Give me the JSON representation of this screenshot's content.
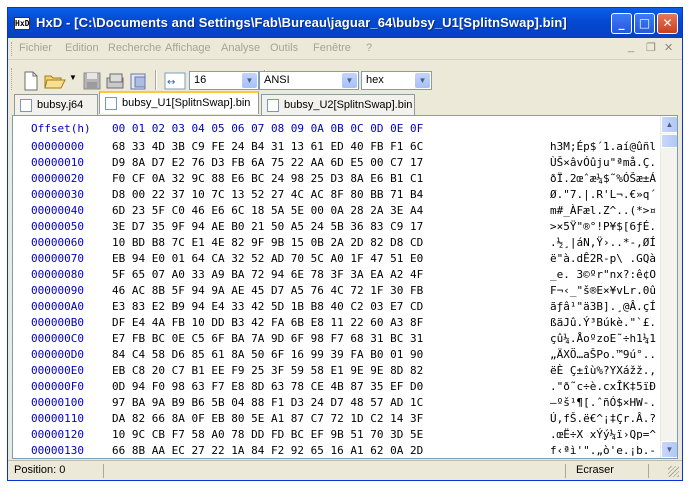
{
  "window": {
    "app_icon_text": "HxD",
    "title": "HxD - [C:\\Documents and Settings\\Fab\\Bureau\\jaguar_64\\bubsy_U1[SplitnSwap].bin]",
    "caption_buttons": {
      "minimize": "_",
      "maximize": "□",
      "close": "✕"
    }
  },
  "menubar": {
    "items": [
      "Fichier",
      "Edition",
      "Recherche",
      "Affichage",
      "Analyse",
      "Outils",
      "Fenêtre",
      "?"
    ],
    "mdi_buttons": {
      "minimize": "_",
      "restore": "❐",
      "close": "✕"
    }
  },
  "toolbar": {
    "bytes_per_row": "16",
    "charset": "ANSI",
    "display": "hex",
    "icons": [
      "new-file-icon",
      "open-folder-icon",
      "save-icon",
      "save-all-icon",
      "properties-icon",
      "bytes-per-row-icon"
    ]
  },
  "tabs": [
    {
      "label": "bubsy.j64",
      "active": false
    },
    {
      "label": "bubsy_U1[SplitnSwap].bin",
      "active": true
    },
    {
      "label": "bubsy_U2[SplitnSwap].bin",
      "active": false
    }
  ],
  "editor": {
    "offset_header": "Offset(h)",
    "column_header": "00 01 02 03 04 05 06 07 08 09 0A 0B 0C 0D 0E 0F",
    "rows": [
      {
        "offset": "00000000",
        "hex": "68 33 4D 3B C9 FE 24 B4 31 13 61 ED 40 FB F1 6C",
        "text": "h3M;Ép$´1.aí@ûñl"
      },
      {
        "offset": "00000010",
        "hex": "D9 8A D7 E2 76 D3 FB 6A 75 22 AA 6D E5 00 C7 17",
        "text": "ÙŠ×âvÓûju\"ªmå.Ç."
      },
      {
        "offset": "00000020",
        "hex": "F0 CF 0A 32 9C 88 E6 BC 24 98 25 D3 8A E6 B1 C1",
        "text": "ðÏ.2œˆæ¼$˜%ÓŠæ±Á"
      },
      {
        "offset": "00000030",
        "hex": "D8 00 22 37 10 7C 13 52 27 4C AC 8F 80 BB 71 B4",
        "text": "Ø.\"7.|.R'L¬.€»q´"
      },
      {
        "offset": "00000040",
        "hex": "6D 23 5F C0 46 E6 6C 18 5A 5E 00 0A 28 2A 3E A4",
        "text": "m#_ÀFæl.Z^..(*>¤"
      },
      {
        "offset": "00000050",
        "hex": "3E D7 35 9F 94 AE B0 21 50 A5 24 5B 36 83 C9 17",
        "text": ">×5Ÿ\"®°!P¥$[6ƒÉ."
      },
      {
        "offset": "00000060",
        "hex": "10 BD B8 7C E1 4E 82 9F 9B 15 0B 2A 2D 82 D8 CD",
        "text": ".½¸|áN‚Ÿ›..*-‚ØÍ"
      },
      {
        "offset": "00000070",
        "hex": "EB 94 E0 01 64 CA 32 52 AD 70 5C A0 1F 47 51 E0",
        "text": "ë\"à.dÊ2R-p\\ .GQà"
      },
      {
        "offset": "00000080",
        "hex": "5F 65 07 A0 33 A9 BA 72 94 6E 78 3F 3A EA A2 4F",
        "text": "_e. 3©ºr\"nx?:ê¢O"
      },
      {
        "offset": "00000090",
        "hex": "46 AC 8B 5F 94 9A AE 45 D7 A5 76 4C 72 1F 30 FB",
        "text": "F¬‹_\"š®E×¥vLr.0û"
      },
      {
        "offset": "000000A0",
        "hex": "E3 83 E2 B9 94 E4 33 42 5D 1B B8 40 C2 03 E7 CD",
        "text": "ãƒâ¹\"ä3B].¸@Â.çÍ"
      },
      {
        "offset": "000000B0",
        "hex": "DF E4 4A FB 10 DD B3 42 FA 6B E8 11 22 60 A3 8F",
        "text": "ßäJû.Ý³Búkè.\"`£."
      },
      {
        "offset": "000000C0",
        "hex": "E7 FB BC 0E C5 6F BA 7A 9D 6F 98 F7 68 31 BC 31",
        "text": "çû¼.ÅoºzoE˜÷h1¼1"
      },
      {
        "offset": "000000D0",
        "hex": "84 C4 58 D6 85 61 8A 50 6F 16 99 39 FA B0 01 90",
        "text": "„ÄXÖ…aŠPo.™9ú°.."
      },
      {
        "offset": "000000E0",
        "hex": "EB C8 20 C7 B1 EE F9 25 3F 59 58 E1 9E 9E 8D 82",
        "text": "ëÈ Ç±îù%?YXážž.‚"
      },
      {
        "offset": "000000F0",
        "hex": "0D 94 F0 98 63 F7 E8 8D 63 78 CE 4B 87 35 EF D0",
        "text": ".\"ð˜c÷è.cxÎK‡5ïÐ"
      },
      {
        "offset": "00000100",
        "hex": "97 BA 9A B9 B6 5B 04 88 F1 D3 24 D7 48 57 AD 1C",
        "text": "—ºš¹¶[.ˆñÓ$×HW-."
      },
      {
        "offset": "00000110",
        "hex": "DA 82 66 8A 0F EB 80 5E A1 87 C7 72 1D C2 14 3F",
        "text": "Ú‚fŠ.ë€^¡‡Çr.Â.?"
      },
      {
        "offset": "00000120",
        "hex": "10 9C CB F7 58 A0 78 DD FD BC EF 9B 51 70 3D 5E",
        "text": ".œË÷X xÝý¼ï›Qp=^"
      },
      {
        "offset": "00000130",
        "hex": "66 8B AA EC 27 22 1A 84 F2 92 65 16 A1 62 0A 2D",
        "text": "f‹ªì'\".„ò'e.¡b.-"
      }
    ]
  },
  "statusbar": {
    "position": "Position: 0",
    "mode": "Ecraser"
  }
}
